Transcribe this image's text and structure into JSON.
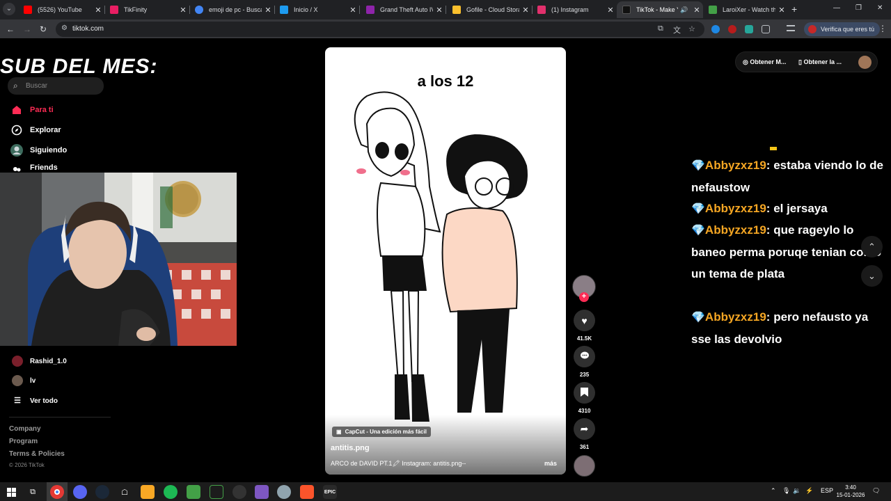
{
  "browser": {
    "tabs": [
      {
        "title": "(5526) YouTube",
        "color": "#ff0000",
        "active": false
      },
      {
        "title": "TikFinity",
        "color": "#e91e63",
        "active": false
      },
      {
        "title": "emoji de pc - Buscar",
        "color": "#4285f4",
        "active": false
      },
      {
        "title": "Inicio / X",
        "color": "#1d9bf0",
        "active": false
      },
      {
        "title": "Grand Theft Auto IV",
        "color": "#8e24aa",
        "active": false
      },
      {
        "title": "Gofile - Cloud Storage",
        "color": "#fbc02d",
        "active": false
      },
      {
        "title": "(1) Instagram",
        "color": "#e1306c",
        "active": false
      },
      {
        "title": "TikTok - Make Yo",
        "color": "#111111",
        "active": true
      },
      {
        "title": "LaroiXer - Watch the",
        "color": "#43a047",
        "active": false
      }
    ],
    "url": "tiktok.com",
    "verify_label": "Verifica que eres tú"
  },
  "overlay": {
    "sub_title": "SUB DEL MES:"
  },
  "sidebar": {
    "search_placeholder": "Buscar",
    "nav": [
      {
        "label": "Para ti",
        "icon": "home-icon"
      },
      {
        "label": "Explorar",
        "icon": "compass-icon"
      },
      {
        "label": "Siguiendo",
        "icon": "following-icon"
      },
      {
        "label": "Friends",
        "icon": "friends-icon"
      }
    ],
    "following": [
      {
        "name": "Rashid_1.0"
      },
      {
        "name": "lv"
      }
    ],
    "see_all": "Ver todo",
    "footer": [
      "Company",
      "Program",
      "Terms & Policies"
    ],
    "copyright": "© 2026 TikTok"
  },
  "video": {
    "caption": "a los 12",
    "capcut_tag": "CapCut - Una edición más fácil",
    "author": "antitis.png",
    "description": "ARCO de DAVID PT.1🖍 Instagram: antitis.png--",
    "more": "más"
  },
  "actions": {
    "likes": "41.5K",
    "comments": "235",
    "saves": "4310",
    "shares": "361"
  },
  "topright": {
    "btn1": "Obtener M...",
    "btn2": "Obtener la ..."
  },
  "chat": [
    {
      "user": "Abbyzxz19",
      "text": "estaba viendo lo de nefaustow"
    },
    {
      "user": "Abbyzxz19",
      "text": "el jersaya"
    },
    {
      "user": "Abbyzxz19",
      "text": "que rageylo lo baneo perma poruqe tenian como un tema de plata"
    },
    {
      "user": "Abbyzxz19",
      "text": "pero nefausto ya sse las devolvio"
    }
  ],
  "taskbar": {
    "lang": "ESP",
    "time": "3:40",
    "date": "15-01-2026"
  }
}
